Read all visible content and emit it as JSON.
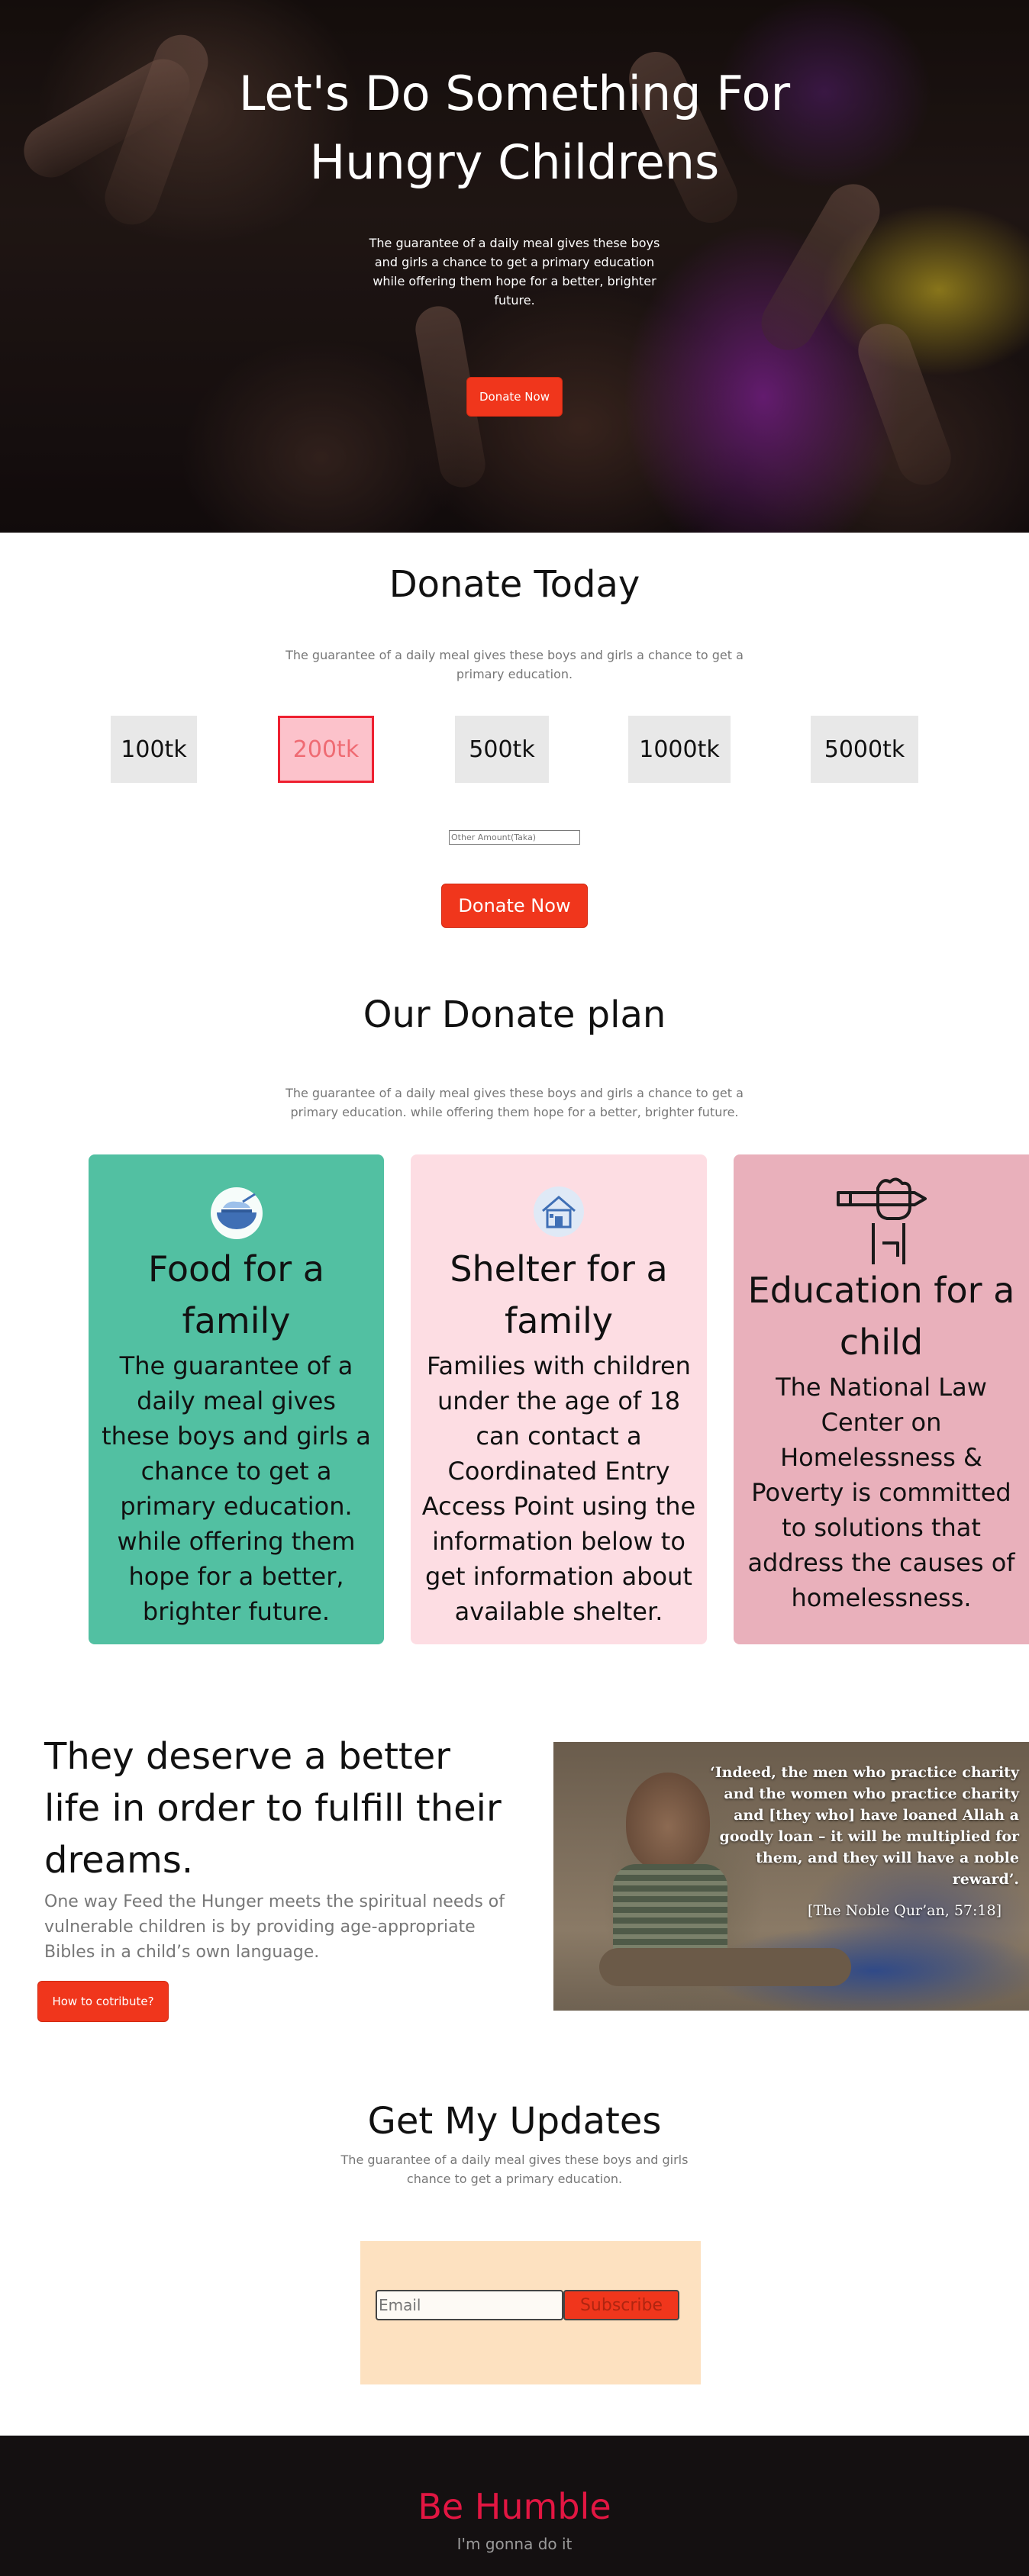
{
  "hero": {
    "title": "Let's Do Something For Hungry Childrens",
    "text": "The guarantee of a daily meal gives these boys and girls a chance to get a primary education while offering them hope for a better, brighter future.",
    "button": "Donate Now"
  },
  "donate": {
    "title": "Donate Today",
    "subtitle": "The guarantee of a daily meal gives these boys and girls a chance to get a primary education.",
    "amounts": [
      "100tk",
      "200tk",
      "500tk",
      "1000tk",
      "5000tk"
    ],
    "selected": "200tk",
    "other_placeholder": "Other Amount(Taka)",
    "button": "Donate Now"
  },
  "plan": {
    "title": "Our Donate plan",
    "subtitle": "The guarantee of a daily meal gives these boys and girls a chance to get a primary education. while offering them hope for a better, brighter future.",
    "cards": [
      {
        "title": "Food for a family",
        "text": "The guarantee of a daily meal gives these boys and girls a chance to get a primary education. while offering them hope for a better, brighter future.",
        "color": "#52c0a2",
        "icon": "food-bowl-icon"
      },
      {
        "title": "Shelter for a family",
        "text": "Families with children under the age of 18 can contact a Coordinated Entry Access Point using the information below to get information about available shelter.",
        "color": "#fddde3",
        "icon": "house-icon"
      },
      {
        "title": "Education for a child",
        "text": "The National Law Center on Homelessness & Poverty is committed to solutions that address the causes of homelessness.",
        "color": "#e9b0bb",
        "icon": "hand-pencil-icon"
      }
    ]
  },
  "better": {
    "title": "They deserve a better life in order to fulfill their dreams.",
    "text": "One way Feed the Hunger meets the spiritual needs of vulnerable children is by providing age-appropriate Bibles in a child’s own language.",
    "button": "How to cotribute?",
    "quote": "‘Indeed, the men who practice charity and the women who practice charity and [they who] have loaned Allah a goodly loan – it will be multiplied for them, and they will have a noble reward’.",
    "quote_source": "[The Noble Qur’an, 57:18]"
  },
  "updates": {
    "title": "Get My Updates",
    "subtitle": "The guarantee of a daily meal gives these boys and girls chance to get a primary education.",
    "email_placeholder": "Email",
    "button": "Subscribe"
  },
  "footer": {
    "title": "Be Humble",
    "text": "I'm gonna do it"
  },
  "colors": {
    "accent": "#f0361c",
    "footer_bg": "#141011",
    "footer_title": "#e21642"
  }
}
